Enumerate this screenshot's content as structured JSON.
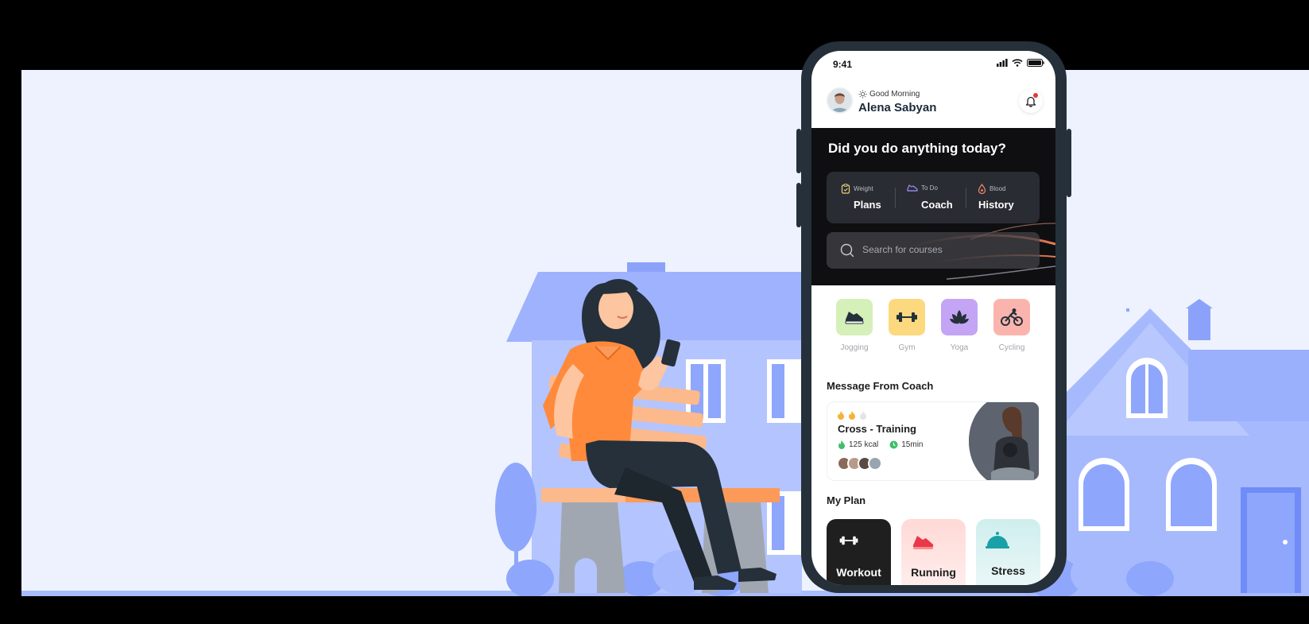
{
  "status_bar": {
    "time": "9:41"
  },
  "header": {
    "greeting": "Good Morning",
    "user_name": "Alena Sabyan"
  },
  "hero": {
    "title": "Did you do anything today?",
    "stats": [
      {
        "label": "Weight",
        "value": "Plans",
        "icon": "clipboard-icon",
        "icon_color": "#e8d27a"
      },
      {
        "label": "To Do",
        "value": "Coach",
        "icon": "sneaker-icon",
        "icon_color": "#9b8cf0"
      },
      {
        "label": "Blood",
        "value": "History",
        "icon": "blood-drop-icon",
        "icon_color": "#f08a6a"
      }
    ],
    "search_placeholder": "Search for courses"
  },
  "categories": [
    {
      "label": "Jogging",
      "icon": "sneaker-icon",
      "color": "#d5f0b8"
    },
    {
      "label": "Gym",
      "icon": "dumbbell-icon",
      "color": "#fcd97e"
    },
    {
      "label": "Yoga",
      "icon": "lotus-icon",
      "color": "#c4a5f5"
    },
    {
      "label": "Cycling",
      "icon": "cyclist-icon",
      "color": "#fbb4ad"
    }
  ],
  "coach_section": {
    "title": "Message From Coach",
    "card": {
      "title": "Cross - Training",
      "calories": "125 kcal",
      "duration": "15min",
      "intensity": 2,
      "intensity_max": 3
    }
  },
  "plan_section": {
    "title": "My Plan",
    "plans": [
      {
        "label": "Workout",
        "icon": "dumbbell-icon"
      },
      {
        "label": "Running",
        "icon": "sneaker-icon"
      },
      {
        "label": "Stress",
        "icon": "bell-dome-icon"
      }
    ]
  },
  "colors": {
    "accent_orange": "#ff8a3c",
    "banner_bg": "#eef2fe",
    "house_blue": "#9eb3fd",
    "phone_frame": "#25303a"
  }
}
